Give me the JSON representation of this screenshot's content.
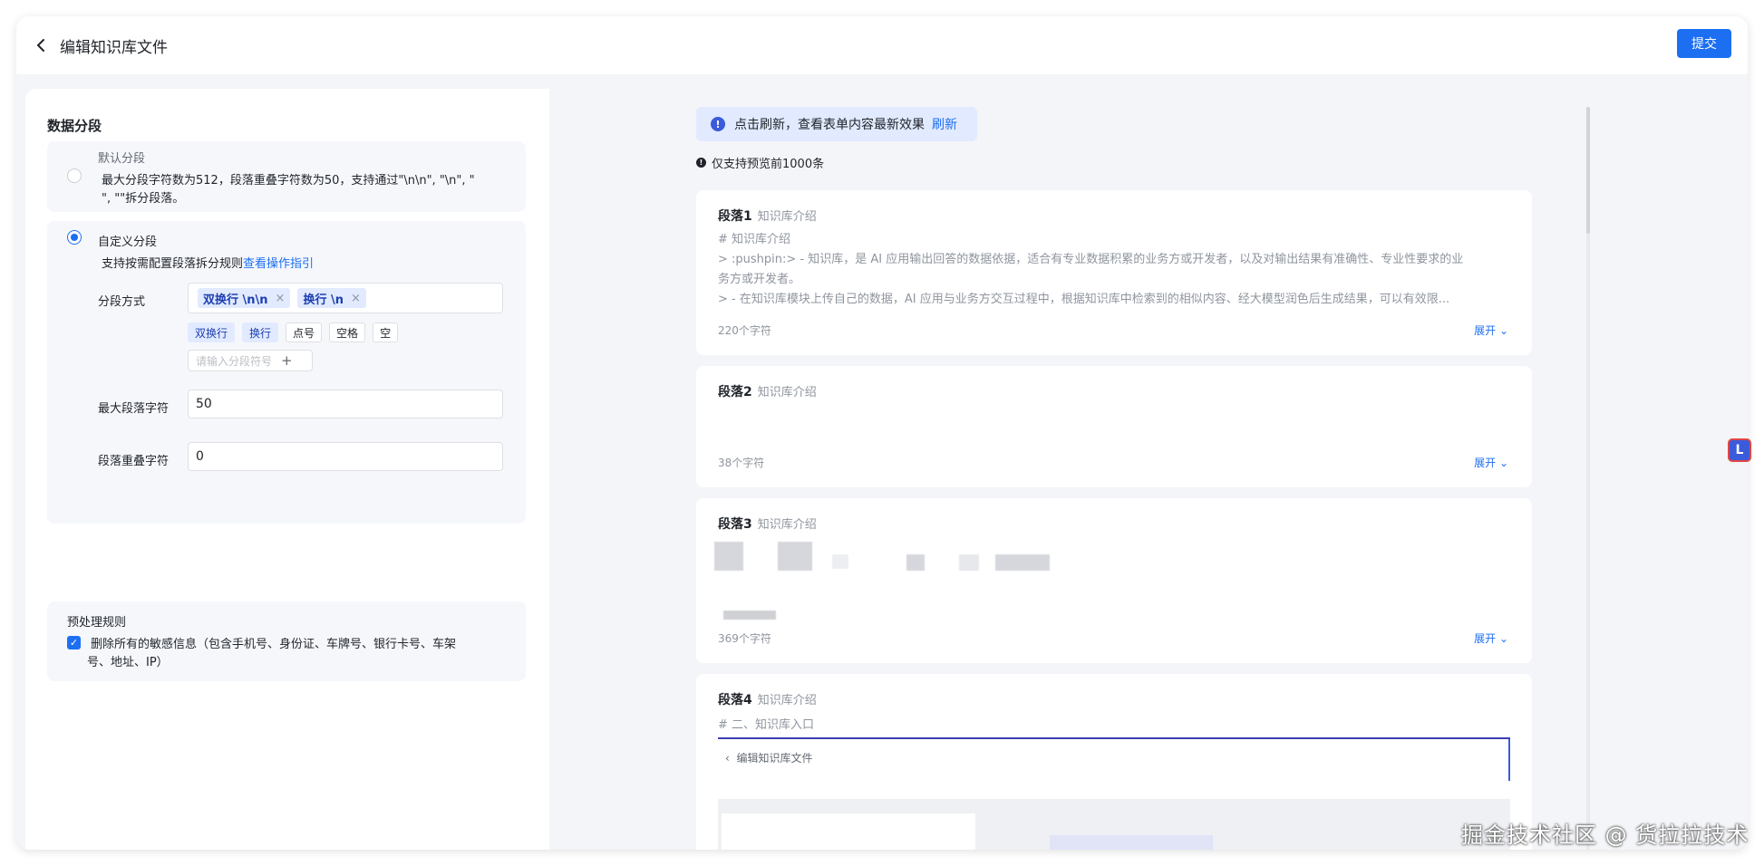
{
  "header": {
    "title": "编辑知识库文件",
    "submit_label": "提交"
  },
  "left": {
    "section_title": "数据分段",
    "default_option": {
      "label": "默认分段",
      "desc_line1": "最大分段字符数为512，段落重叠字符数为50，支持通过\"\\n\\n\", \"\\n\", \"",
      "desc_line2": "\", \"\"拆分段落。"
    },
    "custom_option": {
      "label": "自定义分段",
      "desc": "支持按需配置段落拆分规则",
      "guide_link": "查看操作指引",
      "split_label": "分段方式",
      "selected_tags": [
        "双换行 \\n\\n",
        "换行 \\n"
      ],
      "tag_close": "×",
      "chips": [
        {
          "label": "双换行",
          "selected": true
        },
        {
          "label": "换行",
          "selected": true
        },
        {
          "label": "点号",
          "selected": false
        },
        {
          "label": "空格",
          "selected": false
        },
        {
          "label": "空",
          "selected": false
        }
      ],
      "custom_input_placeholder": "请输入分段符号",
      "add_icon": "+",
      "max_label": "最大段落字符",
      "max_value": "50",
      "overlap_label": "段落重叠字符",
      "overlap_value": "0"
    },
    "preprocess": {
      "title": "预处理规则",
      "rule_line1": "删除所有的敏感信息（包含手机号、身份证、车牌号、银行卡号、车架",
      "rule_line2": "号、地址、IP）",
      "checked": true
    }
  },
  "right": {
    "notice_text": "点击刷新，查看表单内容最新效果",
    "notice_link": "刷新",
    "preview_note": "仅支持预览前1000条",
    "expand_label": "展开",
    "segments": [
      {
        "title": "段落1",
        "subtitle": "知识库介绍",
        "lines": [
          "# 知识库介绍",
          "> :pushpin:> - 知识库，是 AI 应用输出回答的数据依据，适合有专业数据积累的业务方或开发者，以及对输出结果有准确性、专业性要求的业",
          "务方或开发者。",
          "> - 在知识库模块上传自己的数据，AI 应用与业务方交互过程中，根据知识库中检索到的相似内容、经大模型润色后生成结果，可以有效限..."
        ],
        "count": "220个字符"
      },
      {
        "title": "段落2",
        "subtitle": "知识库介绍",
        "lines": [],
        "count": "38个字符"
      },
      {
        "title": "段落3",
        "subtitle": "知识库介绍",
        "lines": [],
        "count": "369个字符"
      },
      {
        "title": "段落4",
        "subtitle": "知识库介绍",
        "lines": [
          "# 二、知识库入口"
        ],
        "embedded_title": "编辑知识库文件",
        "count": ""
      }
    ]
  },
  "watermark": "掘金技术社区 @ 货拉拉技术",
  "colors": {
    "primary": "#1d6ff2",
    "tag_bg": "#e1eaff",
    "page_bg": "#f4f5f8"
  }
}
